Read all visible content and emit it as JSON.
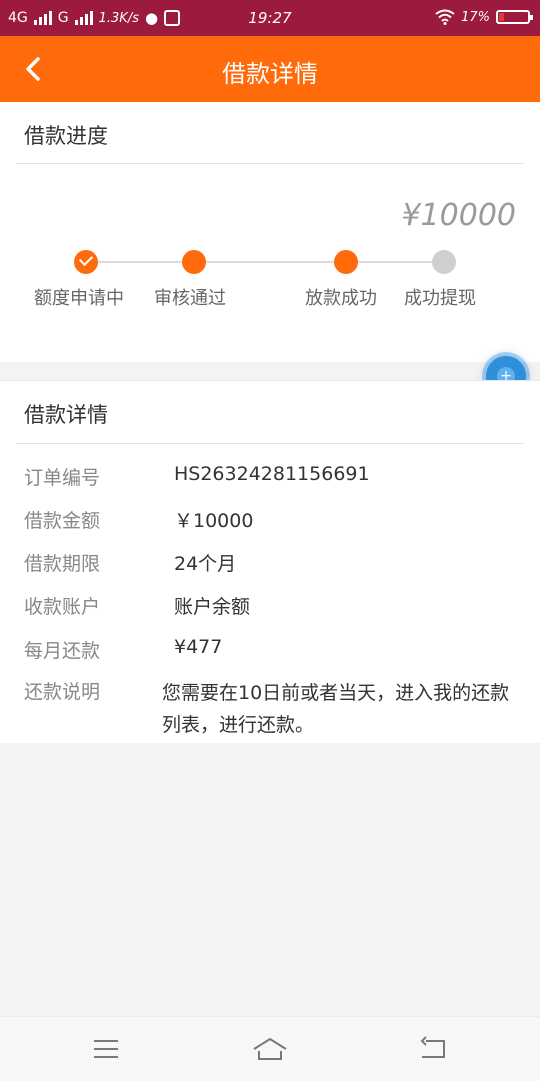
{
  "status_bar": {
    "network1": "4G",
    "network2": "G",
    "speed": "1.3K/s",
    "time": "19:27",
    "battery": "17%",
    "battery_level": 0.17,
    "icons": [
      "signal-icon",
      "qq-icon",
      "app-icon",
      "wifi-icon",
      "battery-icon"
    ]
  },
  "header": {
    "title": "借款详情",
    "back_icon": "chevron-left-icon"
  },
  "progress": {
    "section_title": "借款进度",
    "amount": "¥10000",
    "steps": [
      {
        "label": "额度申请中",
        "state": "done-check"
      },
      {
        "label": "审核通过",
        "state": "done"
      },
      {
        "label": "放款成功",
        "state": "done"
      },
      {
        "label": "成功提现",
        "state": "pending"
      }
    ]
  },
  "details": {
    "section_title": "借款详情",
    "rows": [
      {
        "label": "订单编号",
        "value": "HS26324281156691"
      },
      {
        "label": "借款金额",
        "value": "￥10000"
      },
      {
        "label": "借款期限",
        "value": "24个月"
      },
      {
        "label": "收款账户",
        "value": "账户余额"
      },
      {
        "label": "每月还款",
        "value": "¥477"
      }
    ],
    "note_label": "还款说明",
    "note_value": "您需要在10日前或者当天，进入我的还款列表，进行还款。"
  },
  "nav_bar": {
    "icons": [
      "menu-icon",
      "home-icon",
      "back-icon"
    ]
  },
  "colors": {
    "status_bar": "#9b1a3e",
    "accent": "#ff6a0b",
    "pending": "#cfcfcf",
    "fab": "#2f8fd8"
  }
}
